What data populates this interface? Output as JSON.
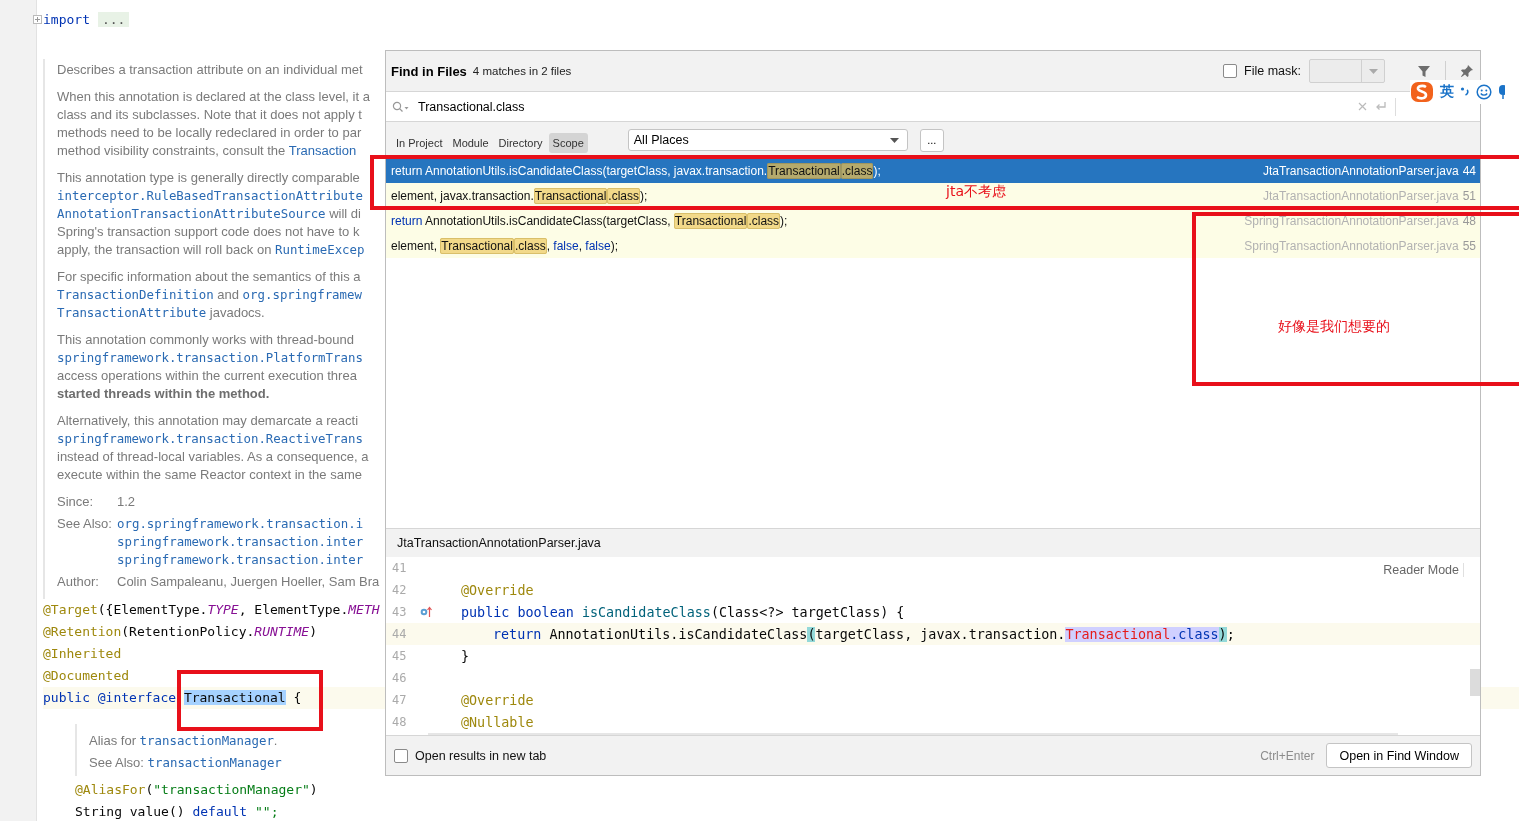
{
  "editor": {
    "import_line": {
      "keyword": "import",
      "folded": "..."
    },
    "doc": {
      "paragraphs": [
        {
          "lines": [
            [
              {
                "text": "Describes a transaction attribute on an individual met",
                "kind": "text"
              }
            ]
          ]
        },
        {
          "lines": [
            [
              {
                "text": "When this annotation is declared at the class level, it a",
                "kind": "text"
              }
            ],
            [
              {
                "text": "class and its subclasses. Note that it does not apply t",
                "kind": "text"
              }
            ],
            [
              {
                "text": "methods need to be locally redeclared in order to par",
                "kind": "text"
              }
            ],
            [
              {
                "text": "method visibility constraints, consult the ",
                "kind": "text"
              },
              {
                "text": "Transaction",
                "kind": "link"
              }
            ]
          ]
        },
        {
          "lines": [
            [
              {
                "text": "This annotation type is generally directly comparable",
                "kind": "text"
              }
            ],
            [
              {
                "text": "interceptor.RuleBasedTransactionAttribute",
                "kind": "code"
              }
            ],
            [
              {
                "text": "AnnotationTransactionAttributeSource",
                "kind": "code"
              },
              {
                "text": " will di",
                "kind": "text"
              }
            ],
            [
              {
                "text": "Spring's transaction support code does not have to k",
                "kind": "text"
              }
            ],
            [
              {
                "text": "apply, the transaction will roll back on ",
                "kind": "text"
              },
              {
                "text": "RuntimeExcep",
                "kind": "code"
              }
            ]
          ]
        },
        {
          "lines": [
            [
              {
                "text": "For specific information about the semantics of this a",
                "kind": "text"
              }
            ],
            [
              {
                "text": "TransactionDefinition",
                "kind": "code"
              },
              {
                "text": " and ",
                "kind": "text"
              },
              {
                "text": "org.springframew",
                "kind": "code"
              }
            ],
            [
              {
                "text": "TransactionAttribute",
                "kind": "code"
              },
              {
                "text": " javadocs.",
                "kind": "text"
              }
            ]
          ]
        },
        {
          "lines": [
            [
              {
                "text": "This annotation commonly works with thread-bound",
                "kind": "text"
              }
            ],
            [
              {
                "text": "springframework.transaction.PlatformTrans",
                "kind": "code"
              }
            ],
            [
              {
                "text": "access operations within the current execution threa",
                "kind": "text"
              }
            ],
            [
              {
                "text": "started threads within the method.",
                "kind": "bold"
              }
            ]
          ]
        },
        {
          "lines": [
            [
              {
                "text": "Alternatively, this annotation may demarcate a reacti",
                "kind": "text"
              }
            ],
            [
              {
                "text": "springframework.transaction.ReactiveTrans",
                "kind": "code"
              }
            ],
            [
              {
                "text": "instead of thread-local variables. As a consequence, a",
                "kind": "text"
              }
            ],
            [
              {
                "text": "execute within the same Reactor context in the same",
                "kind": "text"
              }
            ]
          ]
        }
      ],
      "tags": [
        {
          "label": "Since:",
          "lines": [
            [
              {
                "text": "1.2",
                "kind": "text"
              }
            ]
          ]
        },
        {
          "label": "See Also:",
          "lines": [
            [
              {
                "text": "org.springframework.transaction.i",
                "kind": "code"
              }
            ],
            [
              {
                "text": "springframework.transaction.inter",
                "kind": "code"
              }
            ],
            [
              {
                "text": "springframework.transaction.inter",
                "kind": "code"
              }
            ]
          ]
        },
        {
          "label": "Author:",
          "lines": [
            [
              {
                "text": "Colin Sampaleanu, Juergen Hoeller, Sam Bra",
                "kind": "text"
              }
            ]
          ]
        }
      ]
    },
    "code_lines": [
      {
        "current": false,
        "segments": [
          {
            "text": "@Target",
            "kind": "ann"
          },
          {
            "text": "({ElementType.",
            "kind": "plain"
          },
          {
            "text": "TYPE",
            "kind": "const"
          },
          {
            "text": ", ElementType.",
            "kind": "plain"
          },
          {
            "text": "METH",
            "kind": "const"
          }
        ]
      },
      {
        "current": false,
        "segments": [
          {
            "text": "@Retention",
            "kind": "ann"
          },
          {
            "text": "(RetentionPolicy.",
            "kind": "plain"
          },
          {
            "text": "RUNTIME",
            "kind": "const"
          },
          {
            "text": ")",
            "kind": "plain"
          }
        ]
      },
      {
        "current": false,
        "segments": [
          {
            "text": "@Inherited",
            "kind": "ann"
          }
        ]
      },
      {
        "current": false,
        "segments": [
          {
            "text": "@Documented",
            "kind": "ann"
          }
        ]
      },
      {
        "current": true,
        "segments": [
          {
            "text": "public @interface ",
            "kind": "kw"
          },
          {
            "text": "Transactional",
            "kind": "sel"
          },
          {
            "text": " {",
            "kind": "plain"
          }
        ]
      }
    ],
    "member_doc": {
      "lines": [
        [
          {
            "text": "Alias for ",
            "kind": "text"
          },
          {
            "text": "transactionManager",
            "kind": "code"
          },
          {
            "text": ".",
            "kind": "text"
          }
        ],
        [
          {
            "text": "See Also: ",
            "kind": "text"
          },
          {
            "text": "transactionManager",
            "kind": "code"
          }
        ]
      ]
    },
    "member_lines": [
      {
        "segments": [
          {
            "text": "@AliasFor",
            "kind": "ann"
          },
          {
            "text": "(",
            "kind": "plain"
          },
          {
            "text": "\"transactionManager\"",
            "kind": "string"
          },
          {
            "text": ")",
            "kind": "plain"
          }
        ]
      },
      {
        "segments": [
          {
            "text": "String value() ",
            "kind": "plain"
          },
          {
            "text": "default",
            "kind": "kw"
          },
          {
            "text": " \"\";",
            "kind": "string"
          }
        ]
      }
    ]
  },
  "dialog": {
    "title": "Find in Files",
    "summary": "4 matches in 2 files",
    "file_mask": {
      "label": "File mask:",
      "checked": false
    },
    "search": {
      "value": "Transactional.class"
    },
    "scope_tabs": [
      {
        "label": "In Project",
        "selected": false
      },
      {
        "label": "Module",
        "selected": false
      },
      {
        "label": "Directory",
        "selected": false
      },
      {
        "label": "Scope",
        "selected": true
      }
    ],
    "scope": {
      "value": "All Places",
      "more": "..."
    },
    "results": [
      {
        "selected": true,
        "file": "JtaTransactionAnnotationParser.java",
        "line": "44",
        "segments": [
          {
            "text": "return AnnotationUtils.isCandidateClass(targetClass, javax.transaction.",
            "kind": "plain"
          },
          {
            "text": "Transactional",
            "kind": "match"
          },
          {
            "text": ".class",
            "kind": "match"
          },
          {
            "text": ");",
            "kind": "plain"
          }
        ]
      },
      {
        "selected": false,
        "file": "JtaTransactionAnnotationParser.java",
        "line": "51",
        "segments": [
          {
            "text": "element, javax.transaction.",
            "kind": "plain"
          },
          {
            "text": "Transactional",
            "kind": "match"
          },
          {
            "text": ".class",
            "kind": "match"
          },
          {
            "text": ");",
            "kind": "plain"
          }
        ]
      },
      {
        "selected": false,
        "file": "SpringTransactionAnnotationParser.java",
        "line": "48",
        "segments": [
          {
            "text": "return",
            "kind": "kw"
          },
          {
            "text": " AnnotationUtils.isCandidateClass(targetClass, ",
            "kind": "plain"
          },
          {
            "text": "Transactional",
            "kind": "match"
          },
          {
            "text": ".class",
            "kind": "match"
          },
          {
            "text": ");",
            "kind": "plain"
          }
        ]
      },
      {
        "selected": false,
        "file": "SpringTransactionAnnotationParser.java",
        "line": "55",
        "segments": [
          {
            "text": "element, ",
            "kind": "plain"
          },
          {
            "text": "Transactional",
            "kind": "match"
          },
          {
            "text": ".class",
            "kind": "match"
          },
          {
            "text": ", ",
            "kind": "plain"
          },
          {
            "text": "false",
            "kind": "kw"
          },
          {
            "text": ", ",
            "kind": "plain"
          },
          {
            "text": "false",
            "kind": "kw"
          },
          {
            "text": ");",
            "kind": "plain"
          }
        ]
      }
    ],
    "preview": {
      "file": "JtaTransactionAnnotationParser.java",
      "reader_mode": "Reader Mode",
      "lines": [
        {
          "number": "41",
          "current": false,
          "marker": false
        },
        {
          "number": "42",
          "current": false,
          "marker": false,
          "kind": "member",
          "segments": [
            {
              "text": "@Override",
              "kind": "ann"
            }
          ]
        },
        {
          "number": "43",
          "current": false,
          "marker": true,
          "kind": "member",
          "segments": [
            {
              "text": "public boolean ",
              "kind": "kw"
            },
            {
              "text": "isCandidateClass",
              "kind": "method"
            },
            {
              "text": "(Class<?> targetClass) {",
              "kind": "plain"
            }
          ]
        },
        {
          "number": "44",
          "current": true,
          "marker": false,
          "kind": "body",
          "segments": [
            {
              "text": "return",
              "kind": "kw"
            },
            {
              "text": " AnnotationUtils.isCandidateClass",
              "kind": "plain"
            },
            {
              "text": "(",
              "kind": "brace"
            },
            {
              "text": "targetClass, javax.transaction.",
              "kind": "plain"
            },
            {
              "text": "Transactional",
              "kind": "mred"
            },
            {
              "text": ".class",
              "kind": "mkw"
            },
            {
              "text": ")",
              "kind": "brace"
            },
            {
              "text": ";",
              "kind": "plain"
            }
          ]
        },
        {
          "number": "45",
          "current": false,
          "marker": false,
          "kind": "member",
          "segments": [
            {
              "text": "}",
              "kind": "plain"
            }
          ]
        },
        {
          "number": "46",
          "current": false,
          "marker": false
        },
        {
          "number": "47",
          "current": false,
          "marker": false,
          "kind": "member",
          "segments": [
            {
              "text": "@Override",
              "kind": "ann"
            }
          ]
        },
        {
          "number": "48",
          "current": false,
          "marker": false,
          "kind": "member",
          "segments": [
            {
              "text": "@Nullable",
              "kind": "ann"
            }
          ]
        }
      ]
    },
    "open_new_tab": {
      "label": "Open results in new tab",
      "checked": false
    },
    "shortcut": "Ctrl+Enter",
    "open_button": "Open in Find Window"
  },
  "ime_bar": {
    "label": "英"
  },
  "annotations": [
    {
      "kind": "note",
      "label": "jta不考虑"
    },
    {
      "kind": "note",
      "label": "好像是我们想要的"
    },
    {
      "kind": "box"
    }
  ]
}
